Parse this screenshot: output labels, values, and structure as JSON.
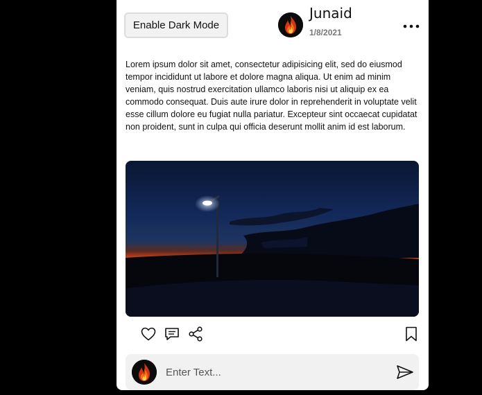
{
  "header": {
    "dark_mode_label": "Enable Dark Mode",
    "author": "Junaid",
    "date": "1/8/2021"
  },
  "post": {
    "body": "Lorem ipsum dolor sit amet, consectetur adipisicing elit, sed do eiusmod tempor incididunt ut labore et dolore magna aliqua. Ut enim ad minim veniam, quis nostrud exercitation ullamco laboris nisi ut aliquip ex ea commodo consequat. Duis aute irure dolor in reprehenderit in voluptate velit esse cillum dolore eu fugiat nulla pariatur. Excepteur sint occaecat cupidatat non proident, sunt in culpa qui officia deserunt mollit anim id est laborum."
  },
  "actions": {
    "icons": [
      "heart-icon",
      "comment-icon",
      "share-icon",
      "bookmark-icon"
    ]
  },
  "comment": {
    "placeholder": "Enter Text...",
    "send_icon": "send-icon"
  },
  "colors": {
    "page_background": "#000000",
    "card_background": "#ffffff",
    "comment_bar_background": "#f1f1f1"
  }
}
